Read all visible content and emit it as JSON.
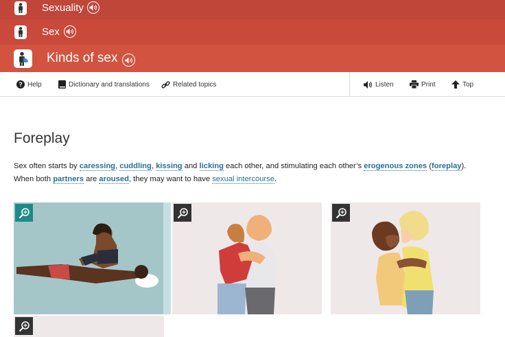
{
  "breadcrumbs": [
    {
      "label": "Sexuality"
    },
    {
      "label": "Sex"
    },
    {
      "label": "Kinds of sex"
    }
  ],
  "toolbar": {
    "help": "Help",
    "dictionary": "Dictionary and translations",
    "related": "Related topics",
    "listen": "Listen",
    "print": "Print",
    "top": "Top"
  },
  "content": {
    "heading": "Foreplay",
    "p_start": "Sex often starts by ",
    "link_caressing": "caressing",
    "sep_comma1": ", ",
    "link_cuddling": "cuddling",
    "sep_comma2": ", ",
    "link_kissing": "kissing",
    "sep_and": " and ",
    "link_licking": "licking",
    "p_mid": " each other, and stimulating each other’s ",
    "link_erogenous": "erogenous zones",
    "paren_open": " (",
    "link_foreplay": "foreplay",
    "paren_close": ").",
    "p_when": "When both ",
    "link_partners": "partners",
    "p_are": " are ",
    "link_aroused": "aroused",
    "p_may": ", they may want to have ",
    "link_intercourse": "sexual intercourse",
    "p_end": "."
  },
  "colors": {
    "crumb1": "#c0463a",
    "crumb2": "#c9493b",
    "crumb3": "#d2533f",
    "link": "#2a6f95",
    "zoom_active": "#1f8a86"
  },
  "icons": [
    "person-icon",
    "speaker-icon",
    "help-icon",
    "book-icon",
    "link-icon",
    "speaker-icon",
    "printer-icon",
    "arrow-up-icon",
    "zoom-icon"
  ]
}
